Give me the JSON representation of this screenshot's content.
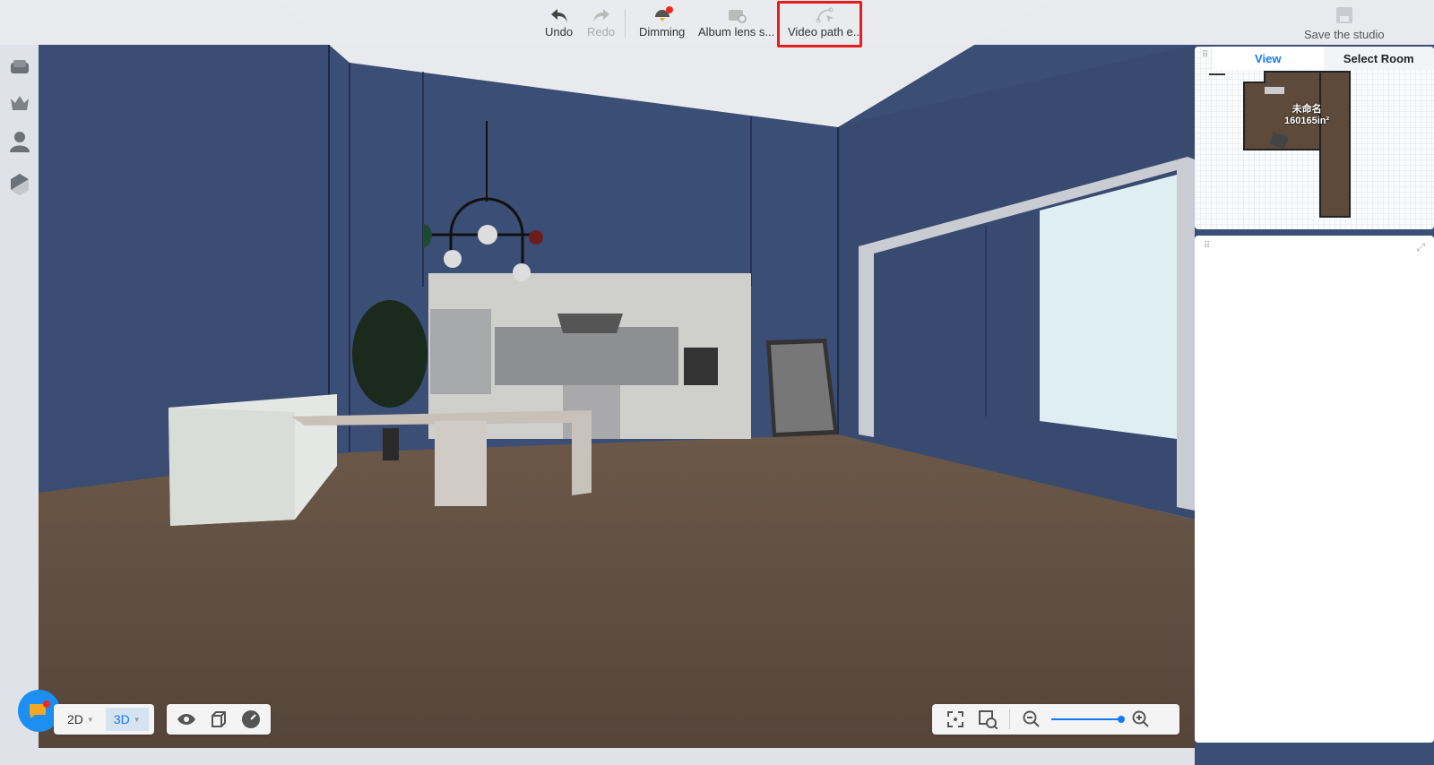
{
  "toolbar": {
    "undo": "Undo",
    "redo": "Redo",
    "dimming": "Dimming",
    "album": "Album lens s...",
    "video": "Video path e...",
    "save": "Save the studio"
  },
  "minimap": {
    "tab_view": "View",
    "tab_select_room": "Select Room",
    "room_name": "未命名",
    "room_area": "160165in²"
  },
  "view_modes": {
    "mode_2d": "2D",
    "mode_3d": "3D",
    "active": "3D"
  },
  "zoom": {
    "level": 1.0
  },
  "colors": {
    "accent": "#1677ff",
    "wall": "#3c4f76",
    "floor": "#5b4a3d",
    "highlight": "#e81c1c"
  }
}
